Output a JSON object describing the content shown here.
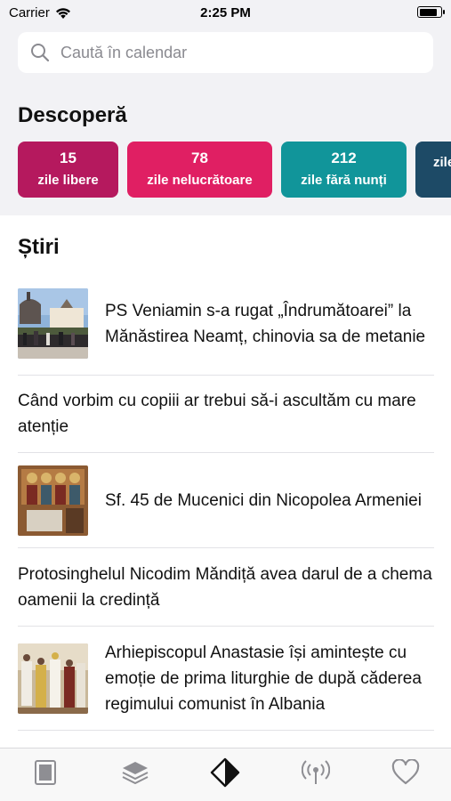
{
  "status_bar": {
    "carrier": "Carrier",
    "time": "2:25 PM",
    "battery_level": 0.9
  },
  "search": {
    "placeholder": "Caută în calendar"
  },
  "discover": {
    "title": "Descoperă",
    "cards": [
      {
        "count": "15",
        "label": "zile libere",
        "color": "#b5195e"
      },
      {
        "count": "78",
        "label": "zile nelucrătoare",
        "color": "#e01f63"
      },
      {
        "count": "212",
        "label": "zile fără nunți",
        "color": "#11959a"
      },
      {
        "count": "",
        "label": "zile",
        "color": "#1d4a66"
      }
    ]
  },
  "news": {
    "title": "Știri",
    "items": [
      {
        "text": "PS Veniamin s-a rugat „Îndrumătoarei” la Mănăstirea Neamț, chinovia sa de metanie",
        "has_image": true,
        "image": "monastery-photo"
      },
      {
        "text": "Când vorbim cu copiii ar trebui să-i ascultăm cu mare atenție",
        "has_image": false
      },
      {
        "text": "Sf. 45 de Mucenici din Nicopolea Armeniei",
        "has_image": true,
        "image": "icon-painting"
      },
      {
        "text": "Protosinghelul Nicodim Măndiță avea darul de a chema oamenii la credință",
        "has_image": false
      },
      {
        "text": "Arhiepiscopul Anastasie își amintește cu emoție de prima liturghie de după căderea regimului comunist în Albania",
        "has_image": true,
        "image": "liturgy-photo"
      }
    ]
  },
  "tabbar": {
    "tabs": [
      {
        "name": "calendar-tab",
        "icon": "book-icon",
        "active": false
      },
      {
        "name": "layers-tab",
        "icon": "layers-icon",
        "active": false
      },
      {
        "name": "discover-tab",
        "icon": "diamond-icon",
        "active": true
      },
      {
        "name": "radio-tab",
        "icon": "broadcast-icon",
        "active": false
      },
      {
        "name": "favorites-tab",
        "icon": "heart-icon",
        "active": false
      }
    ],
    "inactive_color": "#8e8e93",
    "active_color": "#111111"
  }
}
